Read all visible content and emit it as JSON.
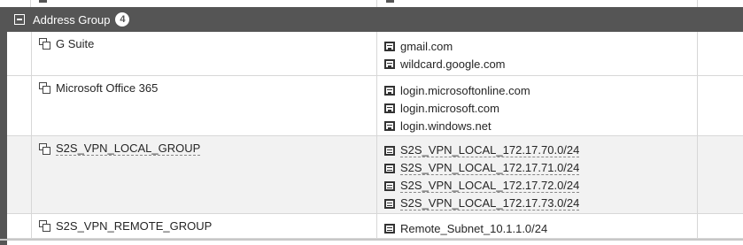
{
  "group": {
    "title": "Address Group",
    "count": "4"
  },
  "rows": [
    {
      "name": "G Suite",
      "members": [
        "gmail.com",
        "wildcard.google.com"
      ]
    },
    {
      "name": "Microsoft Office 365",
      "members": [
        "login.microsoftonline.com",
        "login.microsoft.com",
        "login.windows.net"
      ]
    },
    {
      "name": "S2S_VPN_LOCAL_GROUP",
      "members": [
        "S2S_VPN_LOCAL_172.17.70.0/24",
        "S2S_VPN_LOCAL_172.17.71.0/24",
        "S2S_VPN_LOCAL_172.17.72.0/24",
        "S2S_VPN_LOCAL_172.17.73.0/24"
      ]
    },
    {
      "name": "S2S_VPN_REMOTE_GROUP",
      "members": [
        "Remote_Subnet_10.1.1.0/24"
      ]
    }
  ],
  "icons": {
    "collapse": "minus-square-icon",
    "group": "address-group-icon",
    "fqdn": "fqdn-address-icon",
    "subnet": "subnet-address-icon"
  },
  "colors": {
    "header_bg": "#555555",
    "row_alt_bg": "#f2f2f2",
    "grid": "#d7d7d7"
  }
}
